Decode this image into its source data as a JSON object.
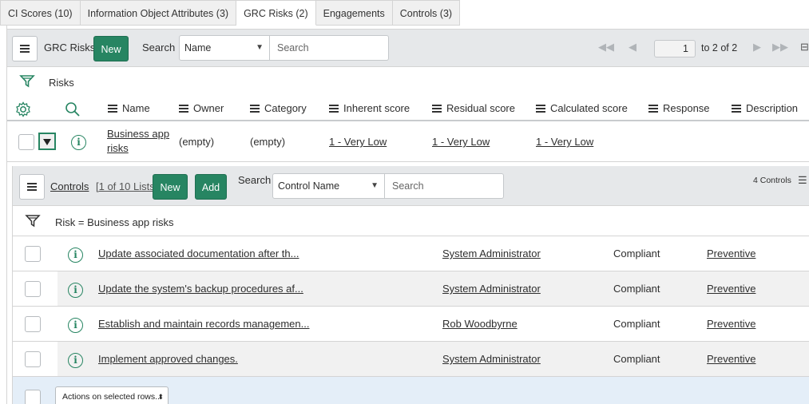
{
  "tabs": [
    "CI Scores (10)",
    "Information Object Attributes (3)",
    "GRC Risks (2)",
    "Engagements",
    "Controls (3)"
  ],
  "active_tab": 2,
  "list": {
    "title": "GRC Risks",
    "new_label": "New",
    "search_label": "Search",
    "search_field": "Name",
    "search_placeholder": "Search",
    "page_value": "1",
    "page_range": "to 2 of 2",
    "filter_label": "Risks",
    "columns": [
      "Name",
      "Owner",
      "Category",
      "Inherent score",
      "Residual score",
      "Calculated score",
      "Response",
      "Description"
    ],
    "row": {
      "name_line1": "Business app",
      "name_line2": "risks",
      "owner": "(empty)",
      "category": "(empty)",
      "inherent": "1 - Very Low",
      "residual": "1 - Very Low",
      "calculated": "1 - Very Low"
    }
  },
  "related": {
    "title": "Controls",
    "subtitle": "[1 of 10 Lists]",
    "new_label": "New",
    "add_label": "Add",
    "search_label": "Search",
    "search_field": "Control Name",
    "search_placeholder": "Search",
    "count_label": "4 Controls",
    "filter_text": "Risk = Business app risks",
    "rows": [
      {
        "name": "Update associated documentation after th...",
        "owner": "System Administrator",
        "status": "Compliant",
        "type": "Preventive"
      },
      {
        "name": "Update the system's backup procedures af...",
        "owner": "System Administrator",
        "status": "Compliant",
        "type": "Preventive"
      },
      {
        "name": "Establish and maintain records managemen...",
        "owner": "Rob Woodbyrne",
        "status": "Compliant",
        "type": "Preventive"
      },
      {
        "name": "Implement approved changes.",
        "owner": "System Administrator",
        "status": "Compliant",
        "type": "Preventive"
      }
    ],
    "actions_label": "Actions on selected rows..."
  },
  "colors": {
    "accent_green": "#278562",
    "header_gray": "#e6e8ea",
    "actions_blue": "#e4eef8"
  }
}
